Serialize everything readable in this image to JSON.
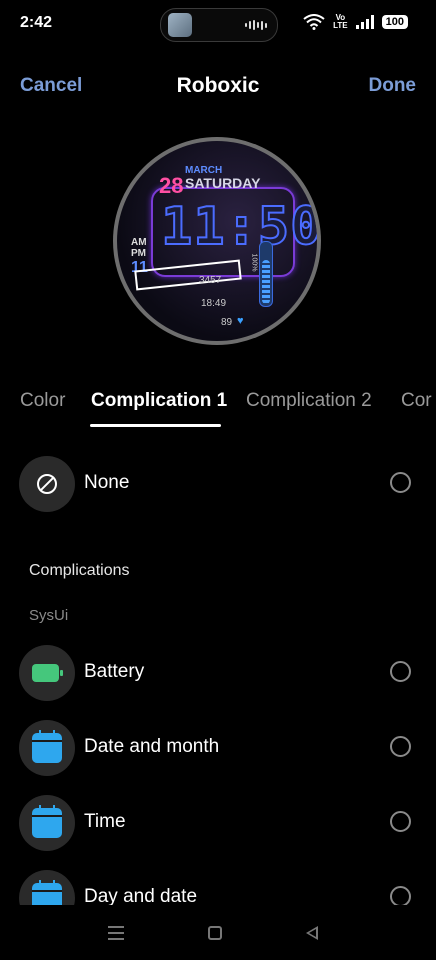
{
  "status_bar": {
    "time": "2:42",
    "volte_top": "Vo",
    "volte_bottom": "LTE",
    "battery": "100"
  },
  "header": {
    "cancel_label": "Cancel",
    "title": "Roboxic",
    "done_label": "Done"
  },
  "watch_face": {
    "day_number": "28",
    "month": "MARCH",
    "weekday": "SATURDAY",
    "time": "11:50",
    "am": "AM",
    "pm": "PM",
    "small_hour": "11",
    "steps": "3457",
    "secondary_time": "18:49",
    "heart_rate": "89",
    "battery_percent": "100%"
  },
  "tabs": [
    "Color",
    "Complication 1",
    "Complication 2",
    "Cor"
  ],
  "active_tab": "Complication 1",
  "options": {
    "none": {
      "label": "None",
      "icon": "none-icon"
    },
    "section_title": "Complications",
    "subsection_title": "SysUi",
    "items": [
      {
        "label": "Battery",
        "icon": "battery-icon",
        "icon_color": "#45c77c"
      },
      {
        "label": "Date and month",
        "icon": "calendar-icon",
        "icon_color": "#2ea7ee"
      },
      {
        "label": "Time",
        "icon": "calendar-icon",
        "icon_color": "#2ea7ee"
      },
      {
        "label": "Day and date",
        "icon": "calendar-icon",
        "icon_color": "#2ea7ee"
      }
    ]
  },
  "colors": {
    "accent": "#7b9cd6",
    "background": "#000000"
  }
}
